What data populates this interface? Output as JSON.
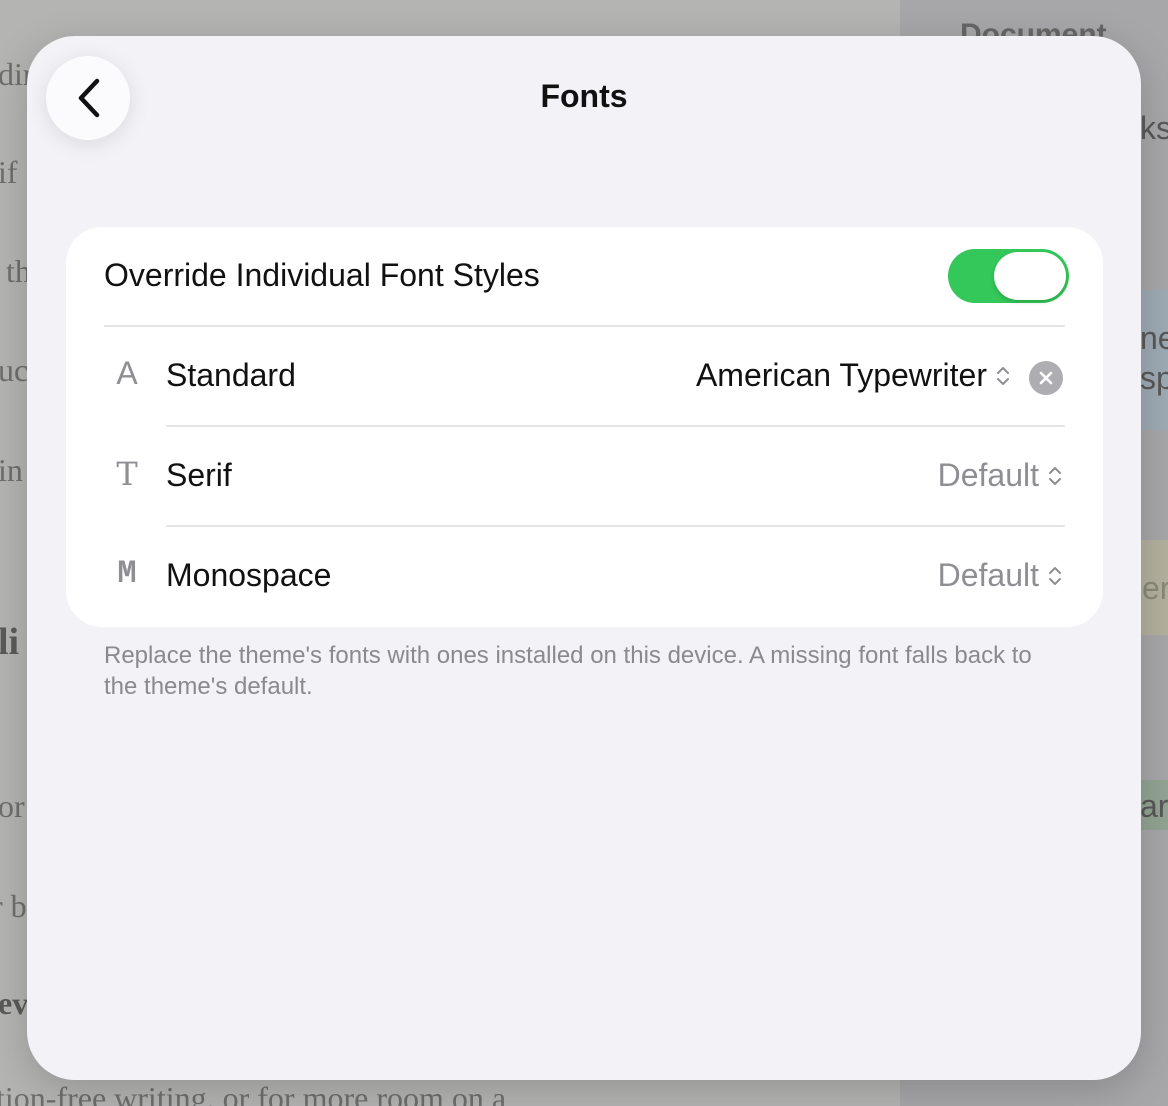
{
  "background": {
    "doc_fragments": [
      "din",
      "if",
      "th",
      "uc",
      "in",
      "li",
      "or",
      "r b",
      "ev",
      "tion-free writing, or for more room on a"
    ],
    "sidebar_title": "Document",
    "sidebar_fragments": [
      "ks",
      "ne",
      "sp",
      "er",
      "art"
    ]
  },
  "sheet": {
    "title": "Fonts",
    "override": {
      "label": "Override Individual Font Styles",
      "enabled": true
    },
    "rows": [
      {
        "icon": "A",
        "label": "Standard",
        "value": "American Typewriter",
        "clearable": true
      },
      {
        "icon": "T",
        "label": "Serif",
        "value": "Default"
      },
      {
        "icon": "M",
        "label": "Monospace",
        "value": "Default"
      }
    ],
    "footnote": "Replace the theme's fonts with ones installed on this device. A missing font falls back to the theme's default."
  },
  "colors": {
    "accent_green": "#34c759",
    "sheet_bg": "#f2f2f7",
    "secondary_text": "#8e8e93",
    "clear_button": "#aeaeb2"
  }
}
